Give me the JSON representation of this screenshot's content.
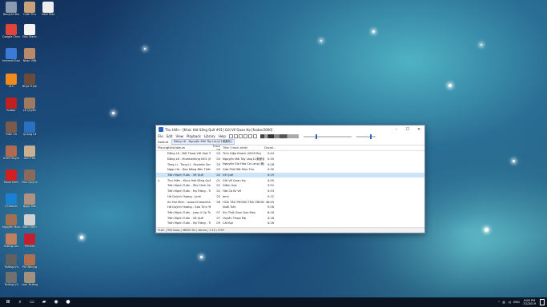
{
  "window": {
    "title": "Thu Hiền - [Khúc Hát Sông Quê #01] Gửi Về Quan Họ [foobar2000]",
    "menu": [
      "File",
      "Edit",
      "View",
      "Playback",
      "Library",
      "Help"
    ],
    "tabs": [
      "Default",
      "Đông Lê - Nguyện Mãi Tây Lâu(11美都化)"
    ],
    "columns": [
      "Playing",
      "Artist/album",
      "Track no",
      "Title / track artist",
      "Durati..."
    ],
    "rows": [
      {
        "artist": "Đông Lê - Đôi Thoại Với Giọt Trọ...",
        "no": "04",
        "title": "Tình Hiệp Khách (2009 Re)",
        "dur": "5:44"
      },
      {
        "artist": "Đông Lê - Mumberking NO1 (Bộ...",
        "no": "05",
        "title": "Nguyện Mãi Tây Lâu(11美都化)",
        "dur": "5:35"
      },
      {
        "artist": "Tùng Li - Tùng Li - Favorite Songs",
        "no": "03",
        "title": "Nguyện Gia Hòa Ca Lang (美都红...",
        "dur": "3:28"
      },
      {
        "artist": "Ngọc Hà - Đọc Nắng Bên Thềm (T...",
        "no": "03",
        "title": "Giọt Phố Dốt Mùa Thu",
        "dur": "4:30"
      },
      {
        "artist": "Trần Mạnh Tuấn - Về Quê",
        "no": "02",
        "title": "Về Quê",
        "dur": "4:19",
        "sel": true
      },
      {
        "artist": "Thu Hiền - Khúc Hát Sông Quê",
        "no": "01",
        "title": "Gửi Về Quan Họ",
        "dur": "4:59",
        "playing": true
      },
      {
        "artist": "Trần Mạnh Tuấn - Yêu Cánh Sen...",
        "no": "02",
        "title": "Diễm Xưa",
        "dur": "3:52"
      },
      {
        "artist": "Trần Mạnh Tuấn - Hạ Trắng - Tiền ...",
        "no": "02",
        "title": "Hát Cò Đi Về",
        "dur": "3:53"
      },
      {
        "artist": "Hồ Quỳnh Hương - Jenh",
        "no": "02",
        "title": "Jenh",
        "dur": "5:12"
      },
      {
        "artist": "An Hai Minh - www.Chiasenhac.c...",
        "no": "08",
        "title": "HÒA TẤU PHONG TRÀ ORIGINAL",
        "dur": "46:49"
      },
      {
        "artist": "Hồ Quỳnh Hương - Sao Tình Yêu",
        "no": "",
        "title": "Nuối Tiếc",
        "dur": "5:26"
      },
      {
        "artist": "Trần Mạnh Tuấn - (sep 4 Up Tiền'...",
        "no": "07",
        "title": "Xin Thời Gian Qua Mau",
        "dur": "6:16"
      },
      {
        "artist": "Trần Mạnh Tuấn - Về Quê",
        "no": "07",
        "title": "Huyền Thoại Mẹ",
        "dur": "4:16"
      },
      {
        "artist": "Trần Mạnh Tuấn - Hạ Trắng - Tiền...",
        "no": "09",
        "title": "Cát Bụi",
        "dur": "4:16"
      }
    ],
    "status": "FLAC | 993 kbps | 48000 Hz | stereo | 1:15 / 4:59"
  },
  "desktop_icons": [
    {
      "label": "Recycle Bin"
    },
    {
      "label": "Cafe Thu"
    },
    {
      "label": "New Text"
    },
    {
      "label": "Google Chrome"
    },
    {
      "label": "Đức Mạnh"
    },
    {
      "label": "Internet Explorer"
    },
    {
      "label": "Nhạc Việt"
    },
    {
      "label": "VLC"
    },
    {
      "label": "Nhạc Trịnh"
    },
    {
      "label": "foobar"
    },
    {
      "label": "Lệ Quyên"
    },
    {
      "label": "Tuấn Vũ"
    },
    {
      "label": "Quang Lê"
    },
    {
      "label": "GOM Player"
    },
    {
      "label": "Anh Thơ"
    },
    {
      "label": "Mạnh Đình"
    },
    {
      "label": "Như Quỳnh"
    },
    {
      "label": "CCleaner"
    },
    {
      "label": "Ngọc Sơn"
    },
    {
      "label": "Nguyễn Hưng"
    },
    {
      "label": "Đàm Vĩnh"
    },
    {
      "label": "Hương Lan"
    },
    {
      "label": "PHONG"
    },
    {
      "label": "Trường Vũ"
    },
    {
      "label": "Phi Nhung"
    },
    {
      "label": "Trường Vũ"
    },
    {
      "label": "Lam Trường"
    }
  ],
  "tray": {
    "lang": "ENG",
    "time": "9:06 PM",
    "date": "7/2/2019"
  }
}
